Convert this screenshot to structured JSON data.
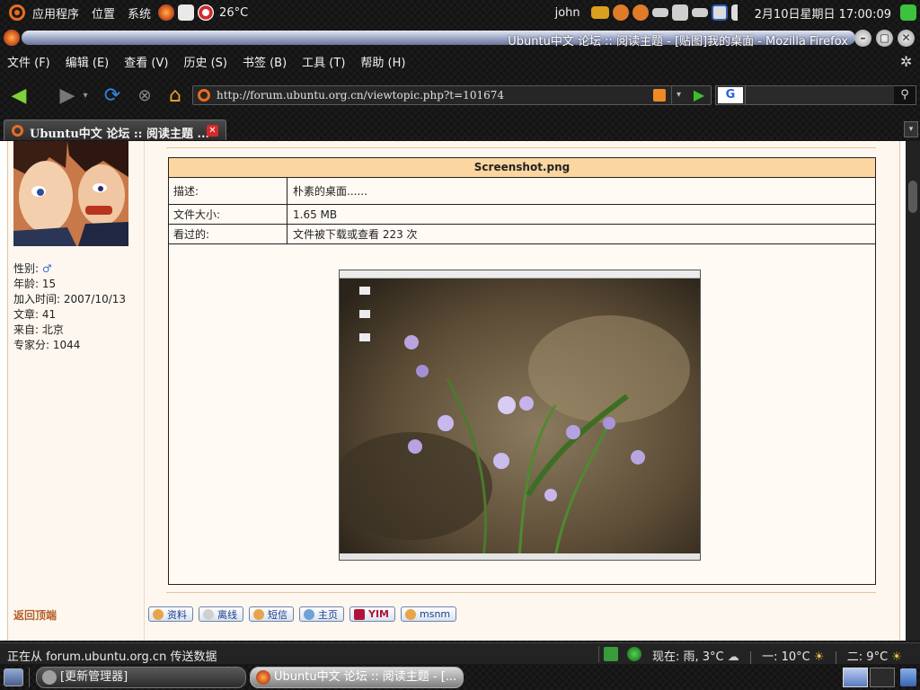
{
  "top_panel": {
    "menus": [
      "应用程序",
      "位置",
      "系统"
    ],
    "temperature": "26°C",
    "user": "john",
    "datetime": "2月10日星期日 17:00:09"
  },
  "window": {
    "title": "Ubuntu中文 论坛 :: 阅读主题 - [贴图]我的桌面 - Mozilla Firefox"
  },
  "menubar": {
    "items": [
      "文件 (F)",
      "编辑 (E)",
      "查看 (V)",
      "历史 (S)",
      "书签 (B)",
      "工具 (T)",
      "帮助 (H)"
    ]
  },
  "navbar": {
    "url": "http://forum.ubuntu.org.cn/viewtopic.php?t=101674",
    "search_engine_letter": "G"
  },
  "tab": {
    "label": "Ubuntu中文 论坛 :: 阅读主题 ...",
    "close": "✕"
  },
  "profile": {
    "gender_label": "性别:",
    "gender_symbol": "♂",
    "age": "年龄: 15",
    "joined": "加入时间: 2007/10/13",
    "posts": "文章: 41",
    "from": "来自: 北京",
    "expert": "专家分: 1044"
  },
  "attachment": {
    "filename": "Screenshot.png",
    "rows": [
      {
        "label": "描述:",
        "value": "朴素的桌面......"
      },
      {
        "label": "文件大小:",
        "value": "1.65 MB"
      },
      {
        "label": "看过的:",
        "value": "文件被下载或查看 223 次"
      }
    ]
  },
  "post_footer": {
    "return_top": "返回顶端",
    "buttons": [
      "资料",
      "离线",
      "短信",
      "主页",
      "YIM",
      "msnm"
    ]
  },
  "statusbar": {
    "text": "正在从 forum.ubuntu.org.cn 传送数据",
    "weather_now": "现在: 雨, 3°C",
    "weather_mon": "一: 10°C",
    "weather_tue": "二: 9°C"
  },
  "taskbar": {
    "tasks": [
      "[更新管理器]",
      "Ubuntu中文 论坛 :: 阅读主题 - [..."
    ]
  }
}
